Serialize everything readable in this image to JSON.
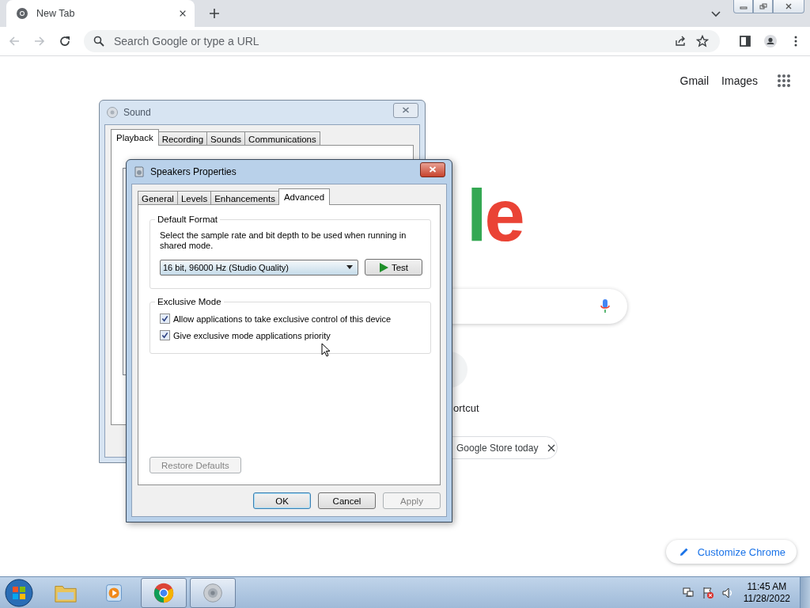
{
  "browser": {
    "tabs": [
      {
        "title": "New Tab",
        "selected": true
      }
    ],
    "omnibox": {
      "placeholder": "Search Google or type a URL"
    }
  },
  "page": {
    "header_links": [
      "Gmail",
      "Images"
    ],
    "logo": "le",
    "shortcut_label": "ortcut",
    "chip": "Google Store today",
    "customize_button": "Customize Chrome"
  },
  "sound_window": {
    "title": "Sound",
    "tabs": [
      {
        "label": "Playback",
        "selected": true
      },
      {
        "label": "Recording",
        "selected": false
      },
      {
        "label": "Sounds",
        "selected": false
      },
      {
        "label": "Communications",
        "selected": false
      }
    ]
  },
  "properties_window": {
    "title": "Speakers Properties",
    "tabs": [
      {
        "label": "General",
        "selected": false
      },
      {
        "label": "Levels",
        "selected": false
      },
      {
        "label": "Enhancements",
        "selected": false
      },
      {
        "label": "Advanced",
        "selected": true
      }
    ],
    "default_format": {
      "legend": "Default Format",
      "description": "Select the sample rate and bit depth to be used when running in shared mode.",
      "format": "16 bit, 96000 Hz (Studio Quality)",
      "test_button": "Test"
    },
    "exclusive_mode": {
      "legend": "Exclusive Mode",
      "options": [
        {
          "label": "Allow applications to take exclusive control of this device",
          "checked": true
        },
        {
          "label": "Give exclusive mode applications priority",
          "checked": true
        }
      ]
    },
    "restore_button": {
      "label": "Restore Defaults",
      "disabled": true
    },
    "buttons": [
      {
        "label": "OK",
        "default": true,
        "disabled": false
      },
      {
        "label": "Cancel",
        "default": false,
        "disabled": false
      },
      {
        "label": "Apply",
        "default": false,
        "disabled": true
      }
    ]
  },
  "taskbar": {
    "apps": [
      {
        "kind": "explorer",
        "open": false
      },
      {
        "kind": "media",
        "open": false
      },
      {
        "kind": "chrome",
        "open": true
      },
      {
        "kind": "sound",
        "open": true
      }
    ],
    "clock": {
      "time": "11:45 AM",
      "date": "11/28/2022"
    }
  }
}
